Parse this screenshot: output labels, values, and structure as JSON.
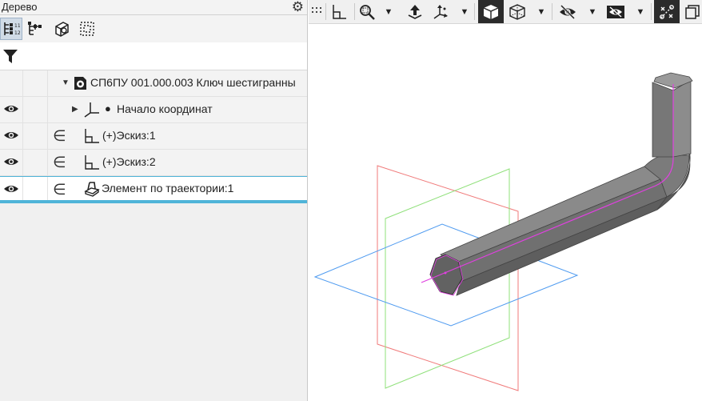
{
  "panel": {
    "title": "Дерево"
  },
  "search": {
    "placeholder": ""
  },
  "tree": {
    "items": [
      {
        "label": "СП6ПУ 001.000.003 Ключ шестигранны"
      },
      {
        "label": "Начало координат"
      },
      {
        "label": "(+)Эскиз:1"
      },
      {
        "label": "(+)Эскиз:2"
      },
      {
        "label": "Элемент по траектории:1"
      }
    ]
  },
  "colors": {
    "selection": "#4fb4d8",
    "plane_red": "#f07a7a",
    "plane_green": "#8fe07a",
    "plane_blue": "#4f9bf0",
    "trajectory": "#e040e0"
  },
  "icons": {
    "panel": [
      "gear-icon"
    ],
    "tree_toolbar": [
      "tree-structure-icon",
      "tree-hierarchy-icon",
      "part-view-icon",
      "frame-select-icon"
    ],
    "view_toolbar": [
      "grip-icon",
      "orient-icon",
      "zoom-icon",
      "move-icon",
      "axes-icon",
      "shaded-cube-icon",
      "wire-cube-icon",
      "hide-icon",
      "visibility-icon",
      "snap-icon",
      "more-icon"
    ]
  }
}
